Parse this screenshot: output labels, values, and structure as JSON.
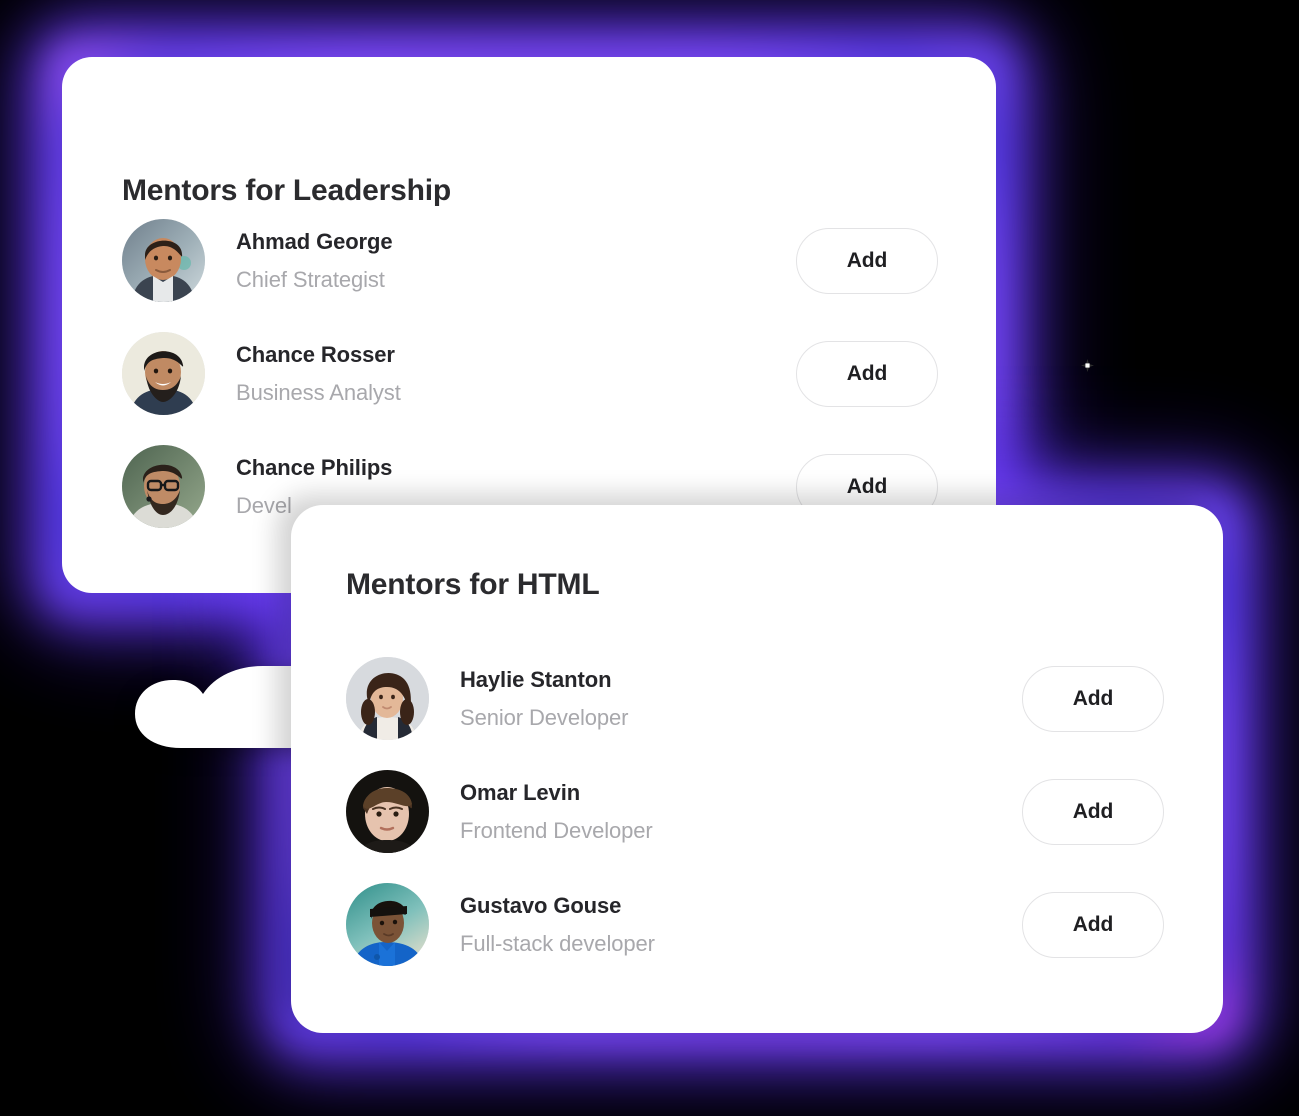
{
  "theme": {
    "background": "#000000",
    "card_background": "#ffffff",
    "glow_color": "#6a3af0",
    "glow_secondary": "#8a2be2",
    "name_color": "#26262a",
    "role_color": "#a8a8ac",
    "button_border": "#e3e3e5",
    "button_text": "#1f1f22"
  },
  "cards": [
    {
      "id": "mentors-leadership",
      "title": "Mentors for Leadership",
      "mentors": [
        {
          "name": "Ahmad George",
          "role": "Chief Strategist",
          "avatar": "avatar-ahmad-george",
          "action_label": "Add"
        },
        {
          "name": "Chance Rosser",
          "role": "Business Analyst",
          "avatar": "avatar-chance-rosser",
          "action_label": "Add"
        },
        {
          "name": "Chance Philips",
          "role": "Devel",
          "avatar": "avatar-chance-philips",
          "action_label": "Add"
        }
      ]
    },
    {
      "id": "mentors-html",
      "title": "Mentors for HTML",
      "mentors": [
        {
          "name": "Haylie Stanton",
          "role": "Senior Developer",
          "avatar": "avatar-haylie-stanton",
          "action_label": "Add"
        },
        {
          "name": "Omar Levin",
          "role": "Frontend Developer",
          "avatar": "avatar-omar-levin",
          "action_label": "Add"
        },
        {
          "name": "Gustavo Gouse",
          "role": "Full-stack developer",
          "avatar": "avatar-gustavo-gouse",
          "action_label": "Add"
        }
      ]
    }
  ]
}
